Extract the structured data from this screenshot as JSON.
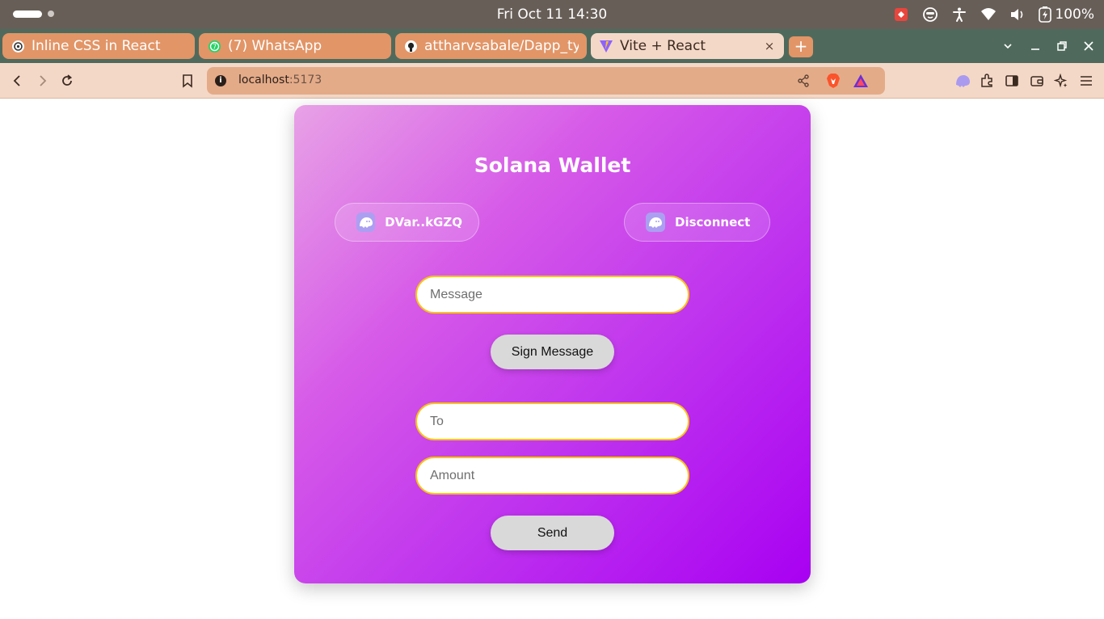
{
  "os_bar": {
    "clock": "Fri Oct 11  14:30",
    "battery": "100%",
    "tray_icons": [
      "screen-record-icon",
      "face-icon",
      "accessibility-icon",
      "wifi-icon",
      "volume-icon",
      "battery-charging-icon"
    ]
  },
  "tabs": [
    {
      "title": "Inline CSS in React",
      "icon": "openai-icon",
      "active": false
    },
    {
      "title": "(7) WhatsApp",
      "icon": "whatsapp-icon",
      "active": false
    },
    {
      "title": "attharvsabale/Dapp_ty",
      "icon": "github-icon",
      "active": false
    },
    {
      "title": "Vite + React",
      "icon": "vite-icon",
      "active": true,
      "close": "×"
    }
  ],
  "new_tab_label": "+",
  "window_controls": {
    "dropdown": "⌄",
    "minimize": "–",
    "maximize": "⧉",
    "close": "✕"
  },
  "address_bar": {
    "host": "localhost",
    "port": ":5173"
  },
  "wallet": {
    "title": "Solana Wallet",
    "address_button": "DVar..kGZQ",
    "disconnect_button": "Disconnect",
    "message_placeholder": "Message",
    "sign_button": "Sign Message",
    "to_placeholder": "To",
    "amount_placeholder": "Amount",
    "send_button": "Send"
  },
  "colors": {
    "os_bar": "#675e57",
    "tab_strip": "#4f6a5d",
    "tab": "#e29567",
    "tab_active": "#f4d8c7",
    "card_gradient_start": "#e8a2e6",
    "card_gradient_end": "#a800f2",
    "input_border": "#f8c315",
    "button_bg": "#d9d9d9"
  }
}
